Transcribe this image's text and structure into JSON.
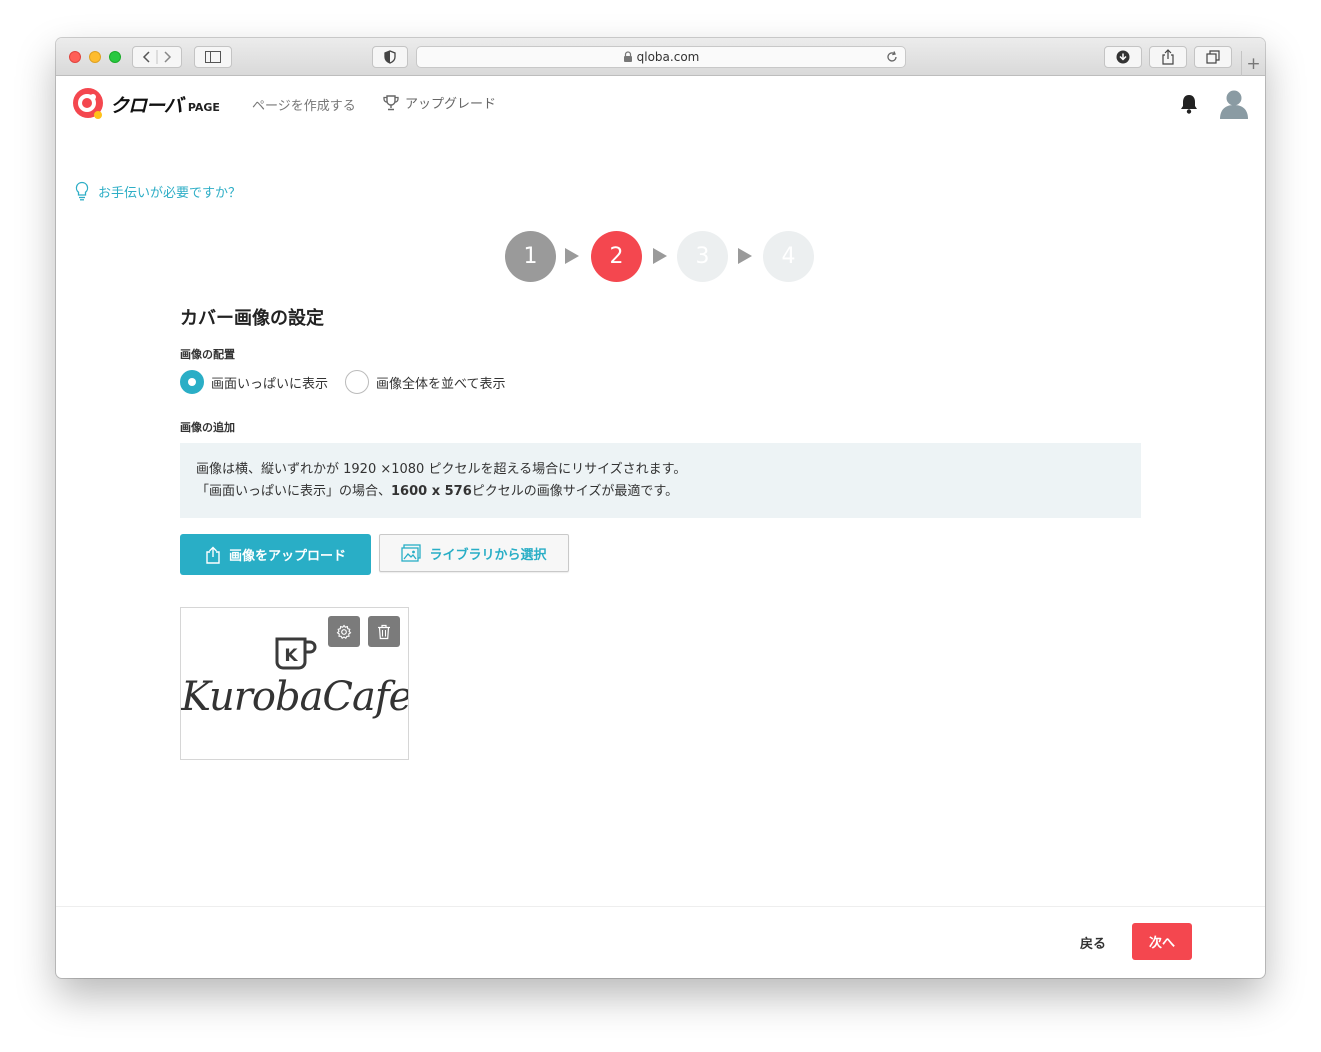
{
  "browser": {
    "url": "qloba.com"
  },
  "header": {
    "logo_text": "クローバ",
    "logo_suffix": "PAGE",
    "nav_create": "ページを作成する",
    "nav_upgrade": "アップグレード"
  },
  "help": {
    "label": "お手伝いが必要ですか？"
  },
  "steps": [
    {
      "number": "1",
      "state": "completed",
      "color": "#9a9a9a"
    },
    {
      "number": "2",
      "state": "current",
      "color": "#f4474f"
    },
    {
      "number": "3",
      "state": "upcoming",
      "color": "#eceff0"
    },
    {
      "number": "4",
      "state": "upcoming",
      "color": "#eceff0"
    }
  ],
  "form": {
    "title": "カバー画像の設定",
    "placement_label": "画像の配置",
    "placement_options": [
      {
        "label": "画面いっぱいに表示",
        "selected": true
      },
      {
        "label": "画像全体を並べて表示",
        "selected": false
      }
    ],
    "add_label": "画像の追加",
    "notice_line1": "画像は横、縦いずれかが 1920 ×1080 ピクセルを超える場合にリサイズされます。",
    "notice_line2_prefix": "「画面いっぱいに表示」の場合、",
    "notice_line2_bold": "1600 x 576",
    "notice_line2_suffix": "ピクセルの画像サイズが最適です。",
    "upload_button": "画像をアップロード",
    "library_button": "ライブラリから選択",
    "image_text": "KurobaCafe",
    "image_logo_letter": "K"
  },
  "footer": {
    "back_button": "戻る",
    "next_button": "次へ"
  },
  "colors": {
    "accent": "#29aec6",
    "primary_red": "#f4474f",
    "step_done": "#9a9a9a",
    "notice_bg": "#edf3f5"
  }
}
